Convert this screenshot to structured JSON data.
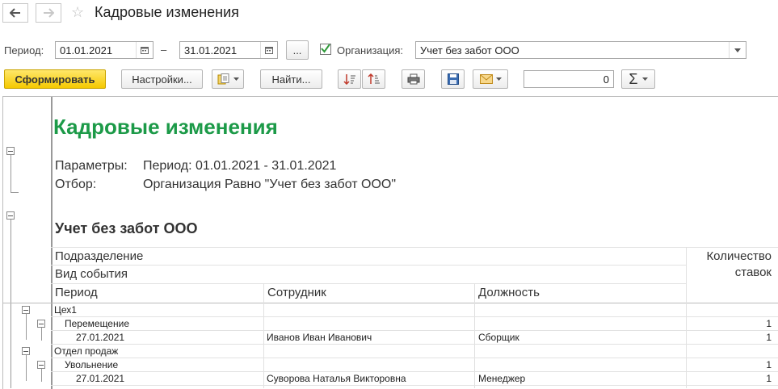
{
  "window": {
    "title": "Кадровые изменения"
  },
  "filters": {
    "period_label": "Период:",
    "date_from": "01.01.2021",
    "dash": "–",
    "date_to": "31.01.2021",
    "more_label": "...",
    "org_label": "Организация:",
    "org_value": "Учет без забот ООО",
    "org_checked": true
  },
  "toolbar": {
    "generate": "Сформировать",
    "settings": "Настройки...",
    "find": "Найти...",
    "sum_value": "0",
    "sum_symbol": "Σ"
  },
  "colors": {
    "title_green": "#1c9a48",
    "accent_yellow": "#f5c900"
  },
  "report": {
    "title": "Кадровые изменения",
    "params_label": "Параметры:",
    "params_value": "Период: 01.01.2021 - 31.01.2021",
    "filter_label": "Отбор:",
    "filter_value": "Организация Равно \"Учет без забот ООО\"",
    "org_heading": "Учет без забот ООО",
    "headers": {
      "division": "Подразделение",
      "event": "Вид события",
      "period": "Период",
      "employee": "Сотрудник",
      "position": "Должность",
      "count_line1": "Количество",
      "count_line2": "ставок"
    },
    "rows": [
      {
        "text": "Цех1",
        "employee": "",
        "position": "",
        "count": ""
      },
      {
        "text": "Перемещение",
        "employee": "",
        "position": "",
        "count": "1"
      },
      {
        "text": "27.01.2021",
        "employee": "Иванов Иван Иванович",
        "position": "Сборщик",
        "count": "1"
      },
      {
        "text": "Отдел продаж",
        "employee": "",
        "position": "",
        "count": ""
      },
      {
        "text": "Увольнение",
        "employee": "",
        "position": "",
        "count": "1"
      },
      {
        "text": "27.01.2021",
        "employee": "Суворова Наталья Викторовна",
        "position": "Менеджер",
        "count": "1"
      }
    ]
  }
}
